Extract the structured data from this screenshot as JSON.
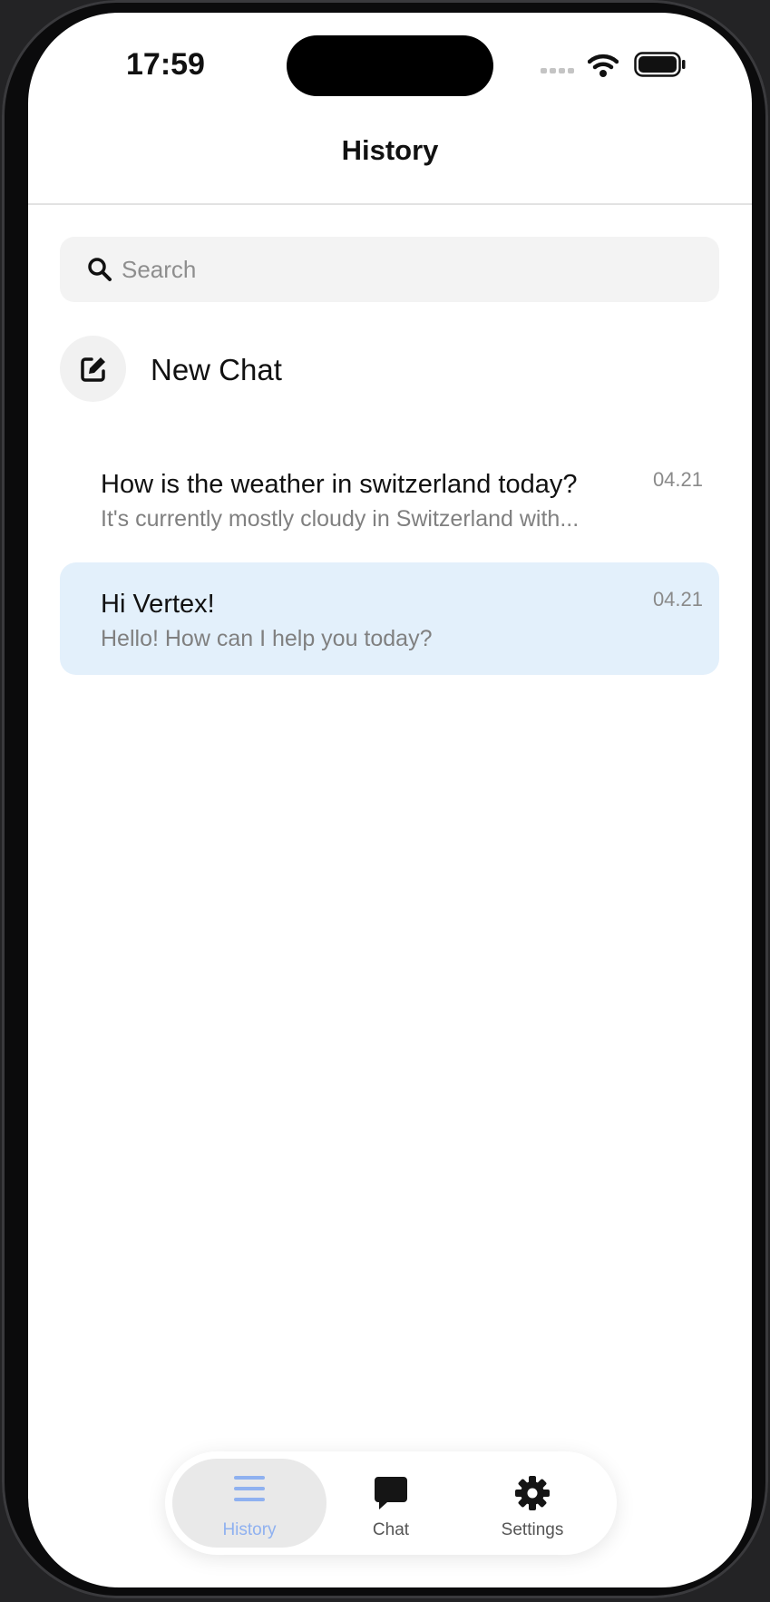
{
  "status_bar": {
    "time": "17:59"
  },
  "header": {
    "title": "History"
  },
  "search": {
    "placeholder": "Search",
    "value": ""
  },
  "new_chat": {
    "label": "New Chat"
  },
  "chats": [
    {
      "title": "How is the weather in switzerland today?",
      "preview": "It's currently mostly cloudy in Switzerland with...",
      "date": "04.21",
      "selected": false
    },
    {
      "title": "Hi Vertex!",
      "preview": "Hello! How can I help you today?",
      "date": "04.21",
      "selected": true
    }
  ],
  "tabs": [
    {
      "label": "History",
      "icon": "bars-icon",
      "active": true
    },
    {
      "label": "Chat",
      "icon": "chat-bubble-icon",
      "active": false
    },
    {
      "label": "Settings",
      "icon": "gear-icon",
      "active": false
    }
  ],
  "colors": {
    "selected_row": "#e3f0fb",
    "active_tab_accent": "#8fb1f0"
  }
}
